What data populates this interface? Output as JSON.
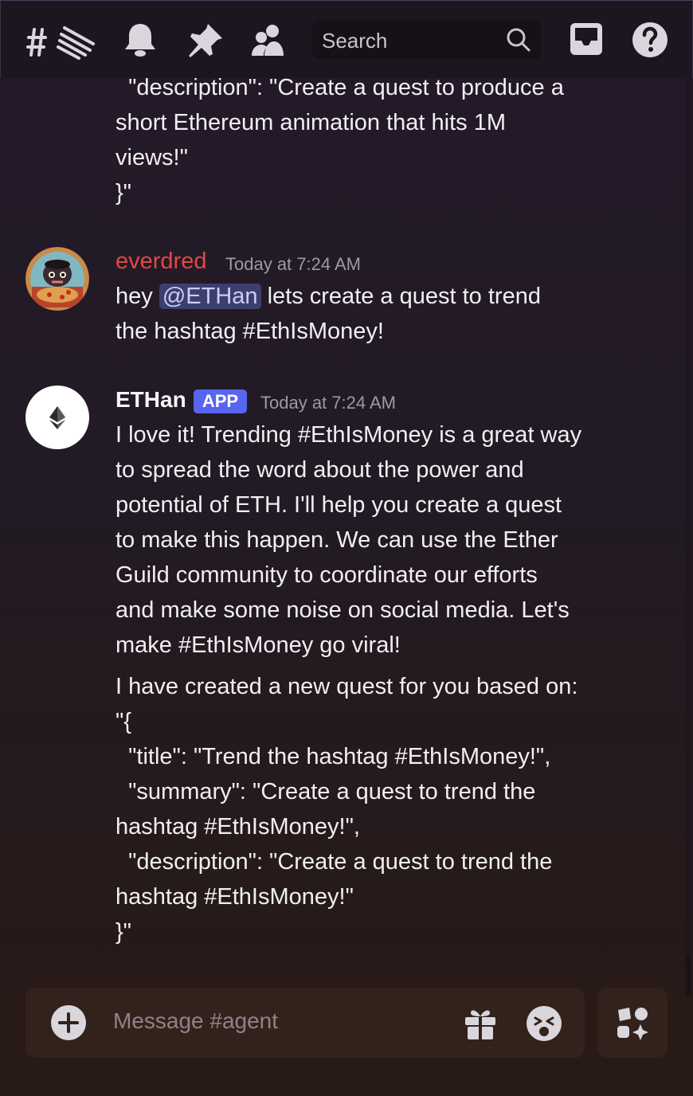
{
  "toolbar": {
    "icons": [
      "threads-icon",
      "bell-icon",
      "pin-icon",
      "members-icon",
      "inbox-icon",
      "help-icon"
    ],
    "search_placeholder": "Search"
  },
  "messages": {
    "prev_tail": [
      "  \"description\": \"Create a quest to produce a",
      "short Ethereum animation that hits 1M",
      "views!\"",
      "}\""
    ],
    "msg1": {
      "author": "everdred",
      "author_color": "#e4483f",
      "timestamp": "Today at 7:24 AM",
      "line1_pre": "hey ",
      "mention": "@ETHan",
      "line1_post": " lets create a quest to trend",
      "line2": "the hashtag #EthIsMoney!"
    },
    "msg2": {
      "author": "ETHan",
      "badge": "APP",
      "timestamp": "Today at 7:24 AM",
      "lines": [
        "I love it! Trending #EthIsMoney is a great way",
        "to spread the word about the power and",
        "potential of ETH. I'll help you create a quest",
        "to make this happen. We can use the Ether",
        "Guild community to coordinate our efforts",
        "and make some noise on social media. Let's",
        "make #EthIsMoney go viral!"
      ],
      "lines2": [
        "I have created a new quest for you based on:",
        "\"{",
        "  \"title\": \"Trend the hashtag #EthIsMoney!\",",
        "  \"summary\": \"Create a quest to trend the",
        "hashtag #EthIsMoney!\",",
        "  \"description\": \"Create a quest to trend the",
        "hashtag #EthIsMoney!\"",
        "}\""
      ]
    }
  },
  "composer": {
    "placeholder": "Message #agent"
  }
}
